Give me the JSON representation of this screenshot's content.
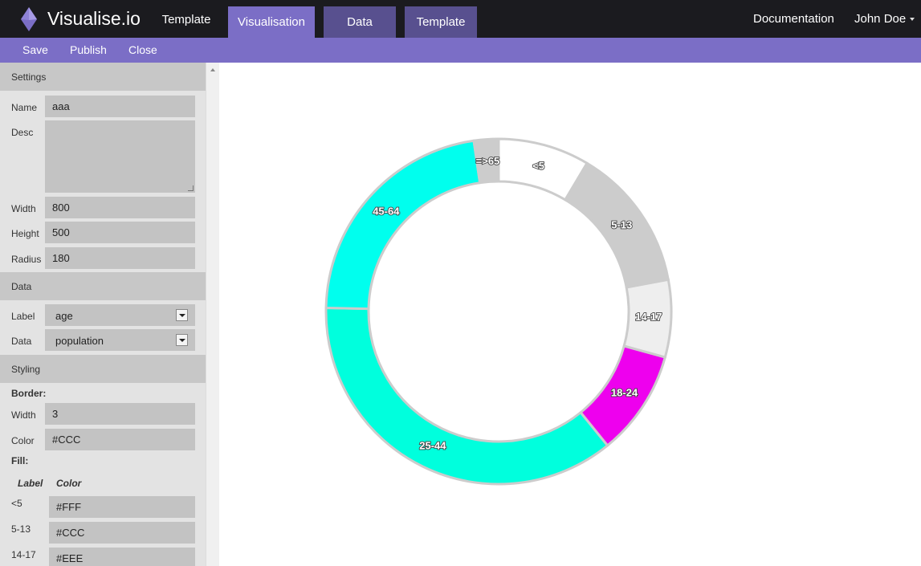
{
  "app": {
    "brand": "Visualise.io"
  },
  "nav": {
    "template_link": "Template",
    "tabs": [
      "Visualisation",
      "Data",
      "Template"
    ],
    "documentation": "Documentation",
    "user": "John Doe"
  },
  "toolbar": {
    "save": "Save",
    "publish": "Publish",
    "close": "Close"
  },
  "settings": {
    "title": "Settings",
    "name_label": "Name",
    "name_value": "aaa",
    "desc_label": "Desc",
    "desc_value": "",
    "width_label": "Width",
    "width_value": "800",
    "height_label": "Height",
    "height_value": "500",
    "radius_label": "Radius",
    "radius_value": "180"
  },
  "data_section": {
    "title": "Data",
    "label_label": "Label",
    "label_value": "age",
    "data_label": "Data",
    "data_value": "population"
  },
  "styling": {
    "title": "Styling",
    "border_heading": "Border:",
    "border_width_label": "Width",
    "border_width_value": "3",
    "border_color_label": "Color",
    "border_color_value": "#CCC",
    "fill_heading": "Fill:",
    "fill_col_label": "Label",
    "fill_col_color": "Color",
    "fills": [
      {
        "label": "<5",
        "color": "#FFF"
      },
      {
        "label": "5-13",
        "color": "#CCC"
      },
      {
        "label": "14-17",
        "color": "#EEE"
      }
    ]
  },
  "colors": {
    "accent": "#7b6ec6",
    "topbar": "#1b1b1f",
    "border": "#cccccc"
  },
  "chart_data": {
    "type": "pie",
    "subtype": "donut",
    "categories": [
      "<5",
      "5-13",
      "14-17",
      "18-24",
      "25-44",
      "45-64",
      "=>65"
    ],
    "values": [
      2.6,
      4.1,
      2.2,
      3.0,
      11.0,
      6.8,
      0.7
    ],
    "colors": [
      "#ffffff",
      "#cccccc",
      "#eeeeee",
      "#ee00ee",
      "#00ffdd",
      "#00ffee",
      "#cccccc"
    ],
    "border_color": "#cccccc"
  }
}
